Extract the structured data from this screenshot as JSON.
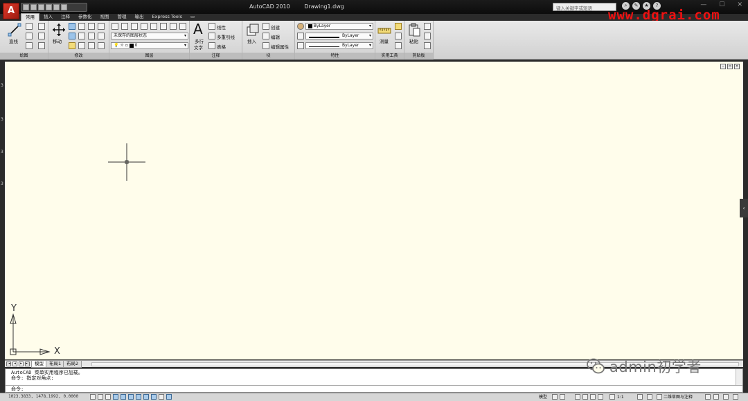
{
  "titlebar": {
    "app_title": "AutoCAD 2010",
    "file_name": "Drawing1.dwg",
    "search_placeholder": "键入关键字或短语",
    "watermark": "www.dgrai.com",
    "logo_letter": "A"
  },
  "ribbon_tabs": [
    "常用",
    "插入",
    "注释",
    "参数化",
    "视图",
    "管理",
    "输出",
    "Express Tools"
  ],
  "ribbon": {
    "draw": {
      "title": "绘图",
      "line_label": "直线"
    },
    "modify": {
      "title": "修改",
      "move_label": "移动"
    },
    "layers": {
      "title": "图层",
      "layer_state": "未保存的图层状态",
      "current_layer": "0"
    },
    "annotation": {
      "title": "注释",
      "mtext_label_1": "多行",
      "mtext_label_2": "文字",
      "linear_label": "线性",
      "mleader_label": "多重引线",
      "table_label": "表格"
    },
    "block": {
      "title": "块",
      "insert_label": "插入",
      "create_label": "创建",
      "edit_label": "编辑",
      "edit_attr_label": "编辑属性"
    },
    "properties": {
      "title": "特性",
      "color": "ByLayer",
      "linetype": "ByLayer",
      "lineweight": "ByLayer"
    },
    "utilities": {
      "title": "实用工具",
      "measure_label": "测量"
    },
    "clipboard": {
      "title": "剪贴板",
      "paste_label": "粘贴"
    }
  },
  "ucs": {
    "x_label": "X",
    "y_label": "Y"
  },
  "ruler_marks": [
    "3",
    "3",
    "3",
    "3"
  ],
  "layout_tabs": [
    "模型",
    "布局1",
    "布局2"
  ],
  "command": {
    "lines": [
      "AutoCAD 菜单实用程序已加载。",
      "命令: 指定对角点:"
    ],
    "prompt": "命令:"
  },
  "statusbar": {
    "coords": "1023.3833, 1478.1992, 0.0000",
    "model_label": "模型",
    "scale": "1:1",
    "workspace": "二维草图与注释"
  },
  "wechat_badge": {
    "text": "admin初学者"
  }
}
